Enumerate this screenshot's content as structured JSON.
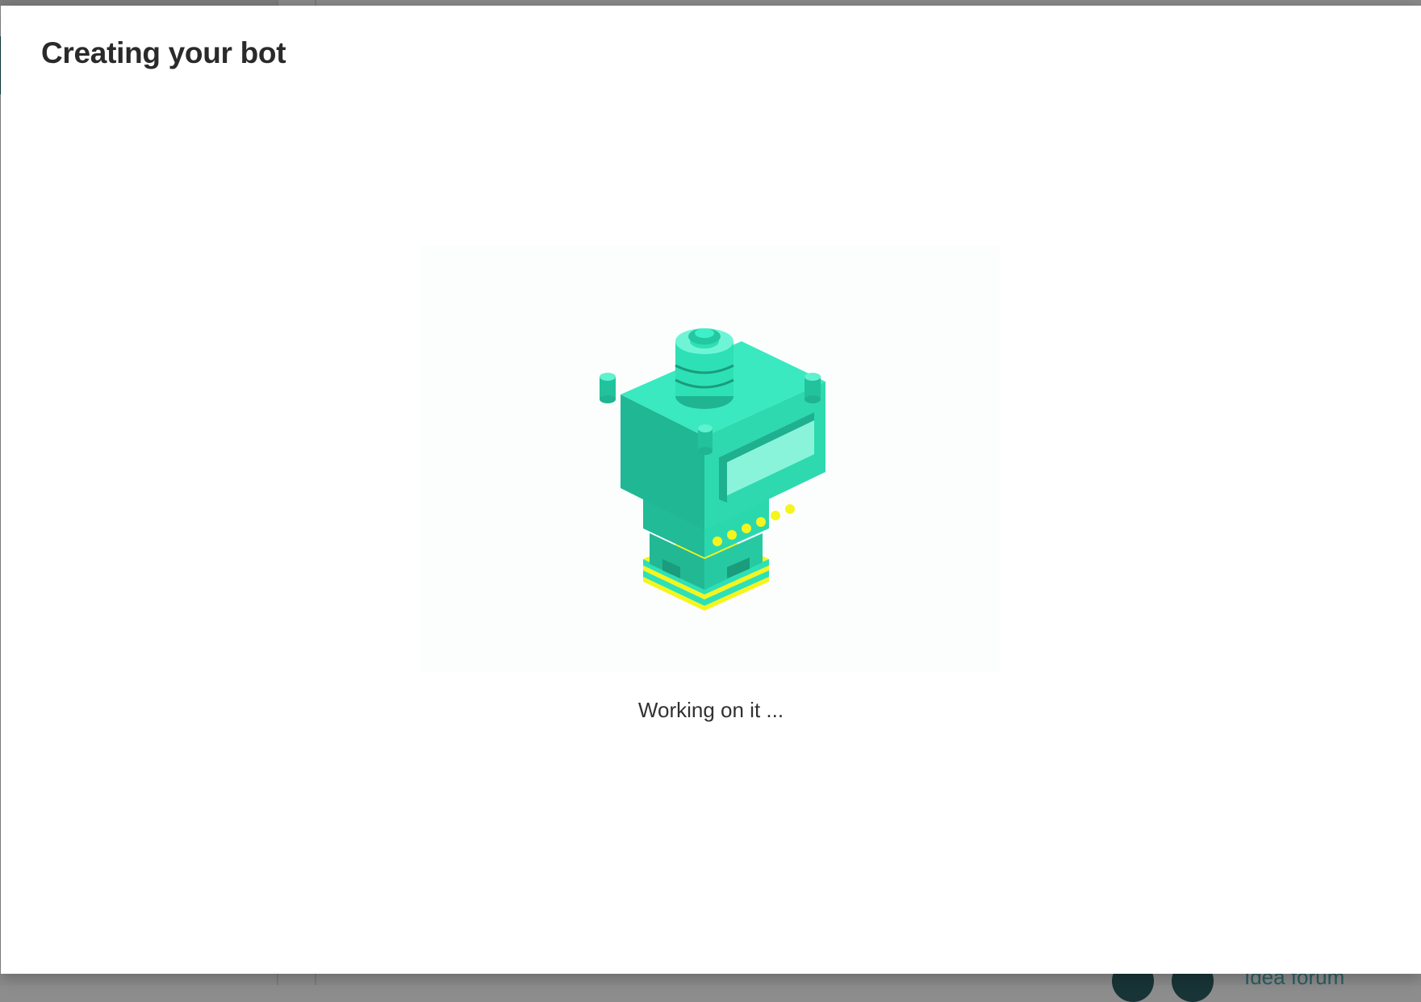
{
  "background": {
    "idea_forum_link": "Idea forum"
  },
  "dialog": {
    "title": "Creating your bot",
    "status": "Working on it ...",
    "illustration_icon": "isometric-bot-build-icon"
  },
  "colors": {
    "overlay": "#8a8a8a",
    "dialog_bg": "#ffffff",
    "title_text": "#2a2a2a",
    "status_text": "#323130",
    "illustration_teal": "#2ee0b6",
    "illustration_teal_dark": "#1fb592",
    "illustration_accent": "#f5f51d"
  }
}
